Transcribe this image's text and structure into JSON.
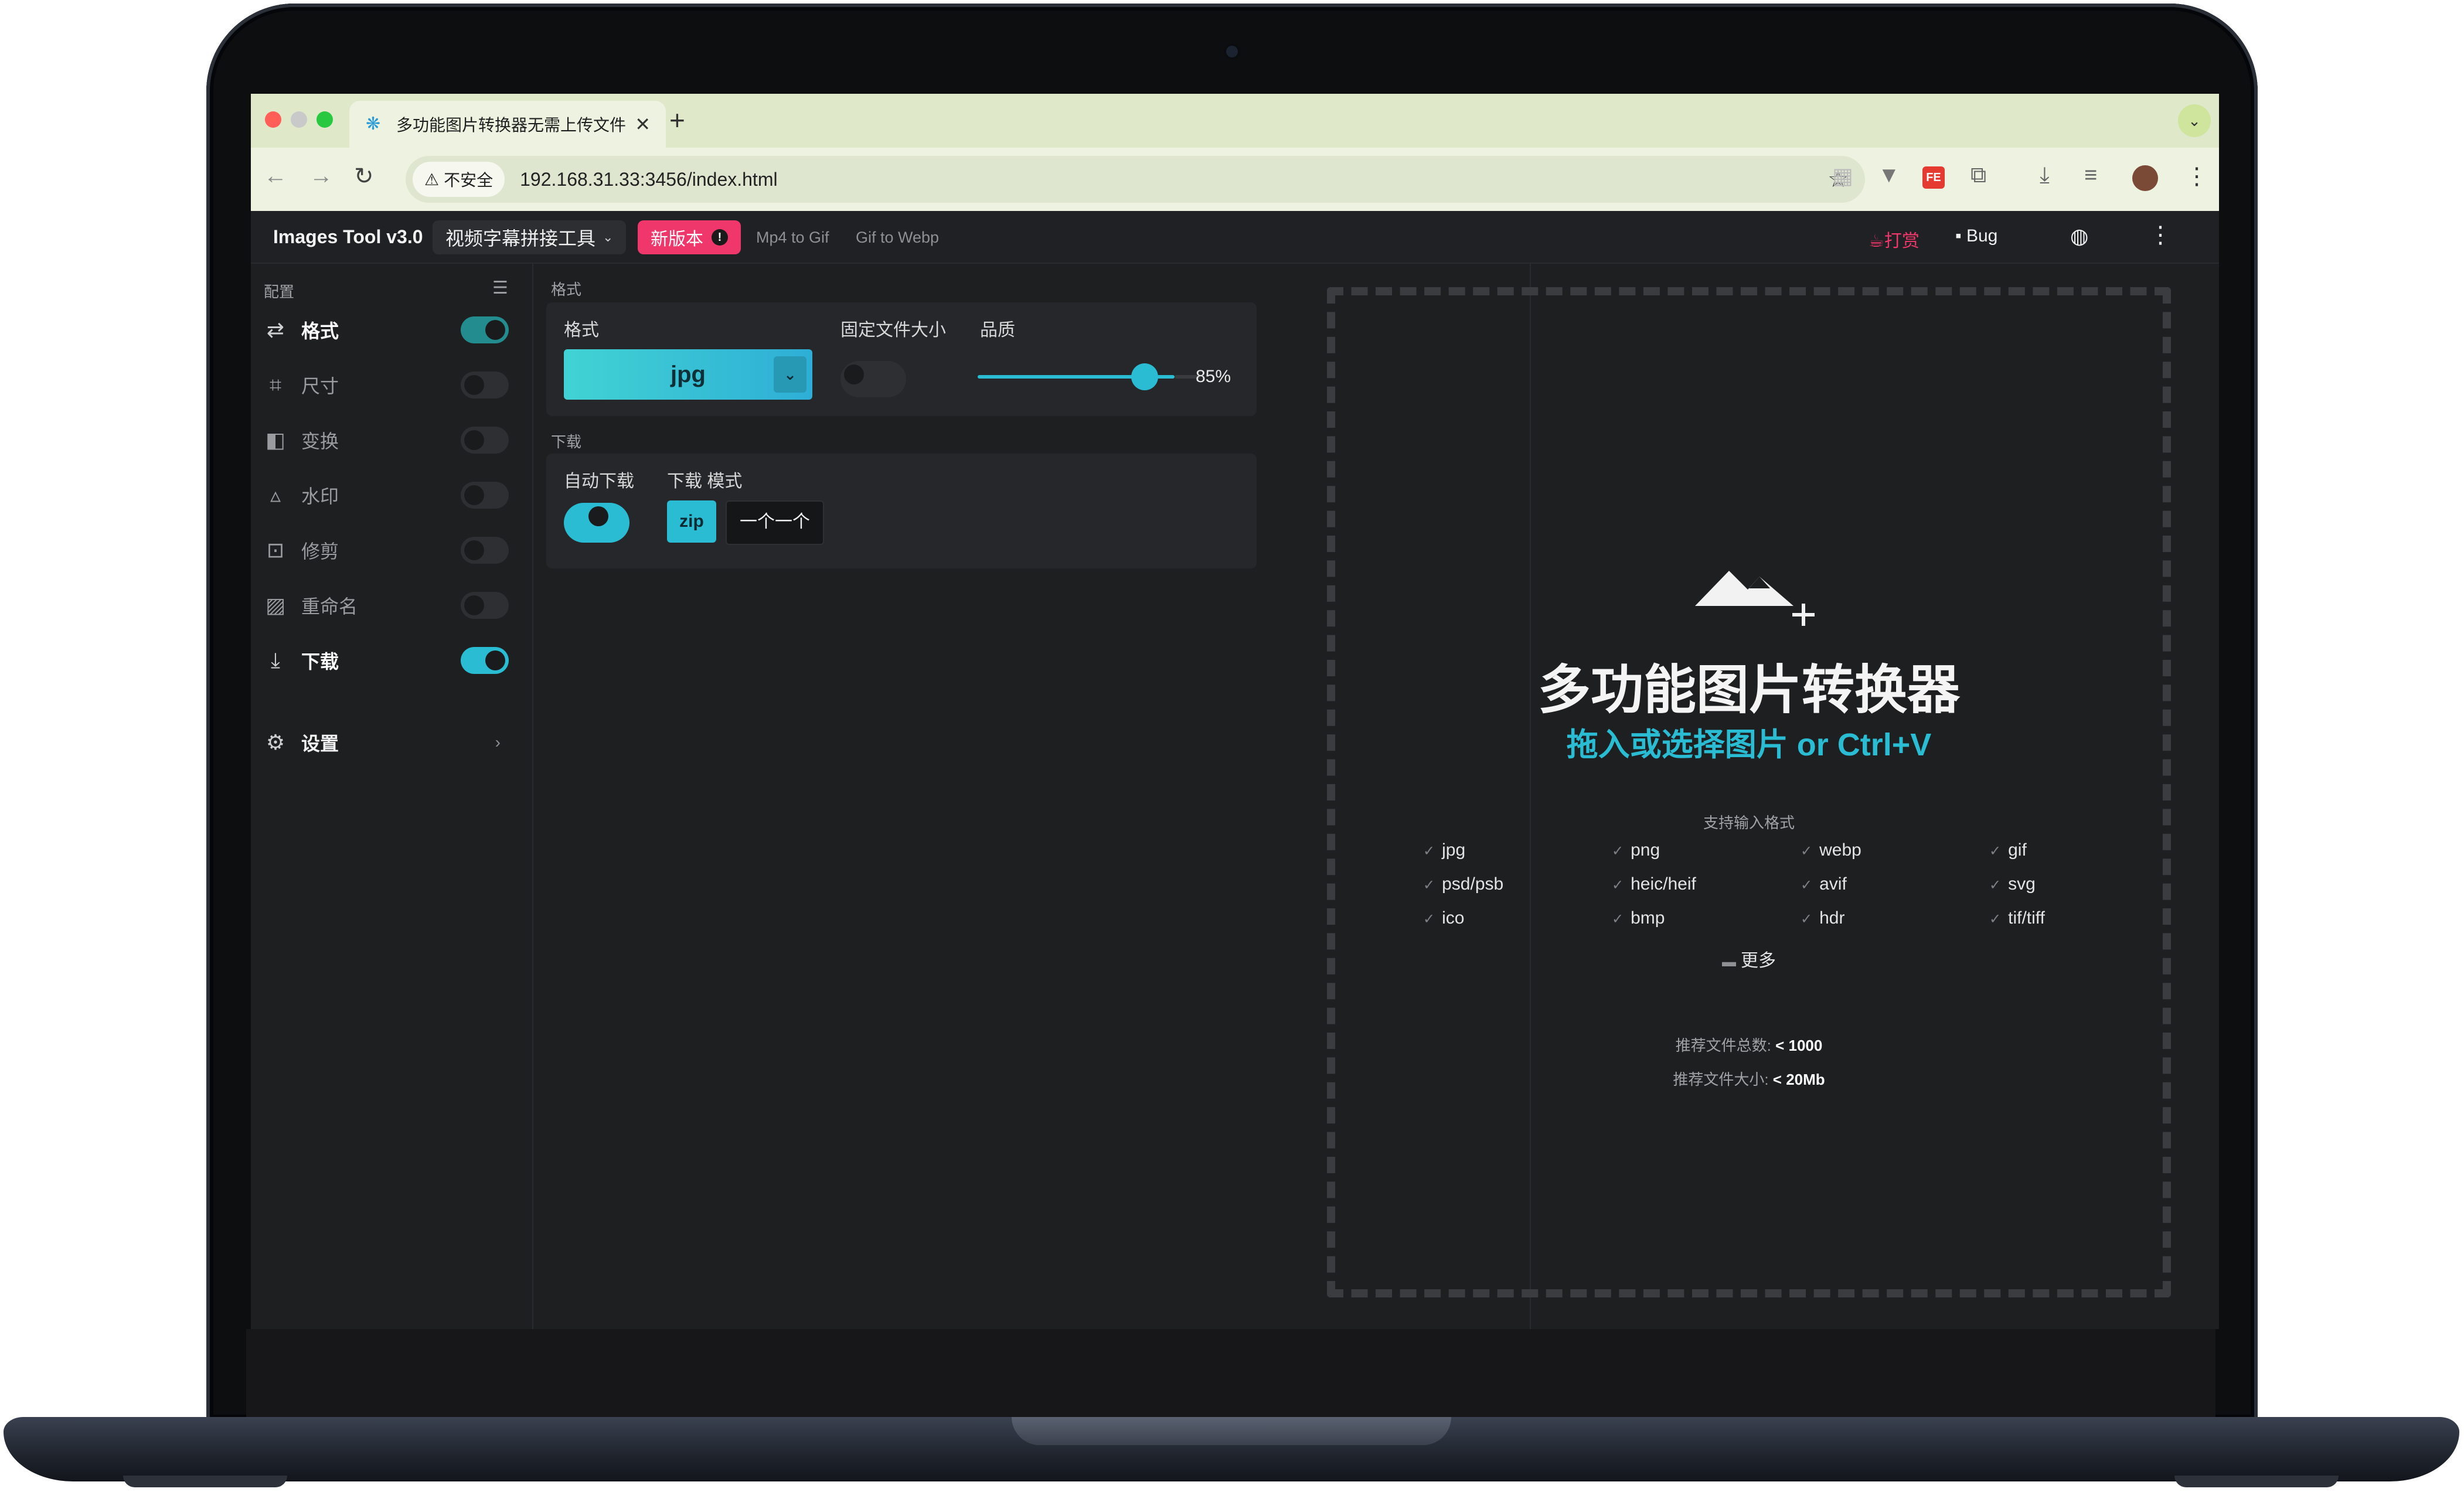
{
  "browser": {
    "tab_title": "多功能图片转换器无需上传文件",
    "tab_close": "✕",
    "new_tab": "+",
    "tab_menu": "⌄",
    "security_label": "不安全",
    "url": "192.168.31.33:3456/index.html"
  },
  "app": {
    "brand": "Images Tool v3.0",
    "tool_select": "视频字幕拼接工具",
    "new_version": "新版本",
    "new_version_badge": "!",
    "links": [
      "Mp4 to Gif",
      "Gif to Webp"
    ],
    "donate": "打赏",
    "bug": "Bug"
  },
  "sidebar": {
    "header": "配置",
    "items": [
      {
        "label": "格式",
        "icon": "swap-icon",
        "enabled": true
      },
      {
        "label": "尺寸",
        "icon": "resize-icon",
        "enabled": false
      },
      {
        "label": "变换",
        "icon": "transform-icon",
        "enabled": false
      },
      {
        "label": "水印",
        "icon": "watermark-icon",
        "enabled": false
      },
      {
        "label": "修剪",
        "icon": "crop-icon",
        "enabled": false
      },
      {
        "label": "重命名",
        "icon": "rename-icon",
        "enabled": false
      },
      {
        "label": "下载",
        "icon": "download-icon",
        "enabled": true
      }
    ],
    "settings_label": "设置"
  },
  "format_section": {
    "title": "格式",
    "format_label": "格式",
    "format_value": "jpg",
    "fixed_size_label": "固定文件大小",
    "fixed_size_enabled": false,
    "quality_label": "品质",
    "quality_value": "85%",
    "quality_fraction": 0.85
  },
  "download_section": {
    "title": "下载",
    "auto_label": "自动下载",
    "auto_enabled": true,
    "mode_label": "下载 模式",
    "modes": [
      "zip",
      "一个一个"
    ],
    "selected_mode": "zip"
  },
  "dropzone": {
    "title": "多功能图片转换器",
    "subtitle": "拖入或选择图片 or Ctrl+V",
    "supported_label": "支持输入格式",
    "formats": [
      "jpg",
      "png",
      "webp",
      "gif",
      "psd/psb",
      "heic/heif",
      "avif",
      "svg",
      "ico",
      "bmp",
      "hdr",
      "tif/tiff"
    ],
    "more": "更多",
    "rec_count_label": "推荐文件总数:",
    "rec_count_value": "< 1000",
    "rec_size_label": "推荐文件大小:",
    "rec_size_value": "< 20Mb"
  },
  "colors": {
    "accent": "#29bcd2",
    "highlight": "#f0376b",
    "background": "#1e1f21"
  }
}
